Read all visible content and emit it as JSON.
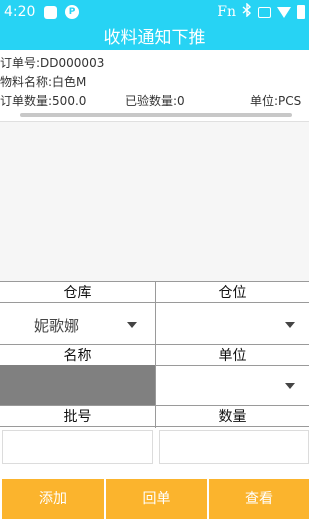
{
  "status_bar": {
    "time": "4:20",
    "p_icon": "P",
    "fn_label": "Fn"
  },
  "title": "收料通知下推",
  "order": {
    "number_label": "订单号:DD000003",
    "material_label": "物料名称:白色M",
    "quantity_label": "订单数量:500.0",
    "inspected_label": "已验数量:0",
    "unit_label": "单位:PCS"
  },
  "form": {
    "warehouse_label": "仓库",
    "location_label": "仓位",
    "warehouse_value": "妮歌娜",
    "location_value": "",
    "name_label": "名称",
    "unit_label": "单位",
    "unit_value": "",
    "batch_label": "批号",
    "quantity_label": "数量",
    "batch_value": "",
    "quantity_value": ""
  },
  "buttons": {
    "add": "添加",
    "return": "回单",
    "view": "查看"
  },
  "colors": {
    "header": "#27d3f4",
    "button": "#fbb42d",
    "name_field": "#808080"
  },
  "icons": [
    "notification-square-icon",
    "p-app-icon",
    "bluetooth-icon",
    "sim-icon",
    "wifi-icon",
    "battery-icon",
    "dropdown-caret-icon"
  ]
}
